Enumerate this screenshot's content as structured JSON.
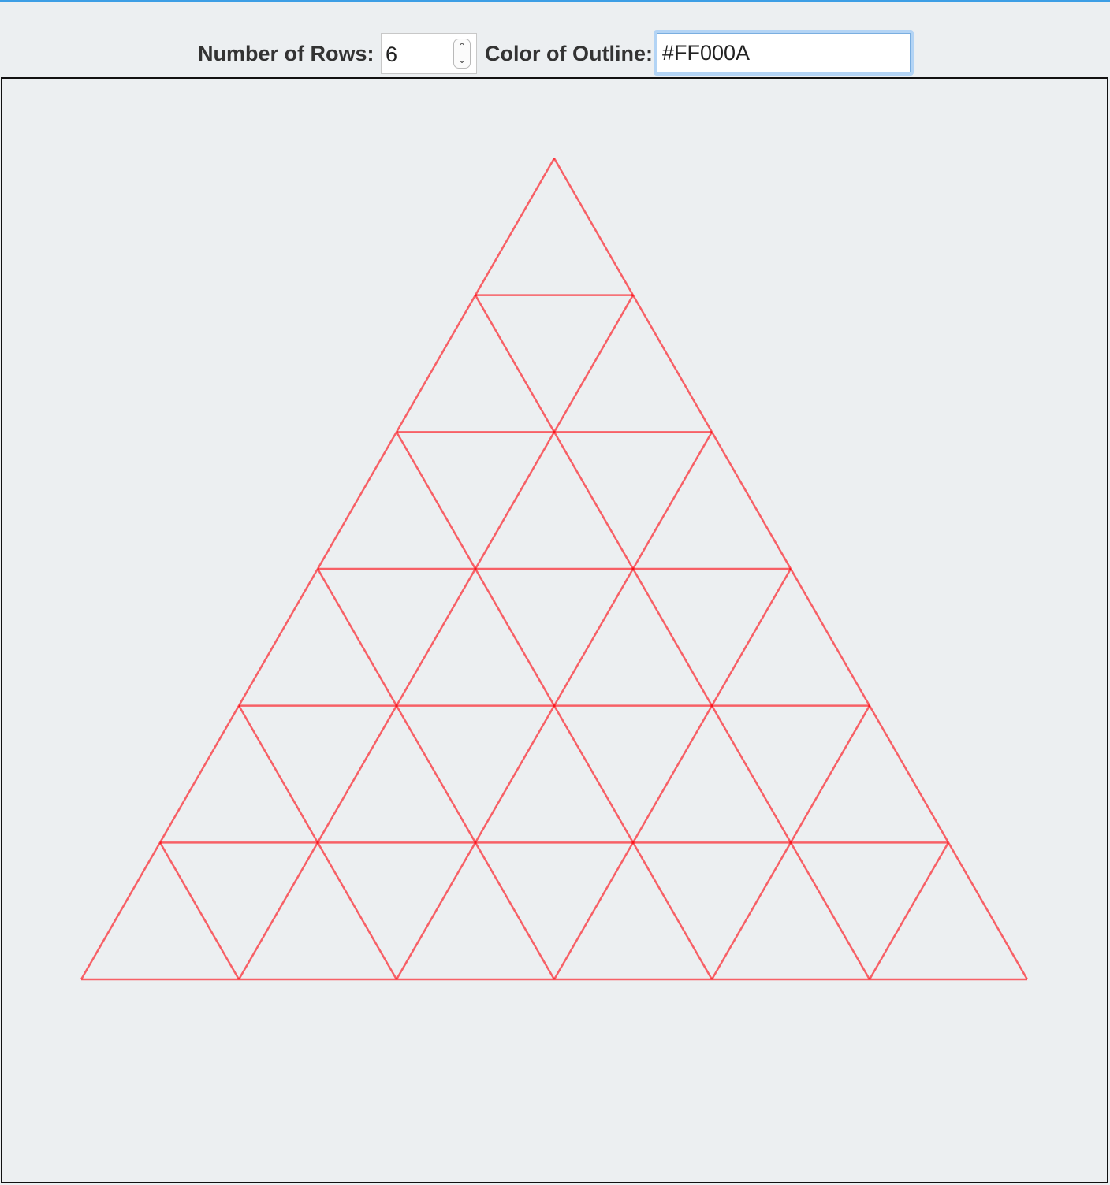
{
  "controls": {
    "rows_label": "Number of Rows:",
    "rows_value": "6",
    "outline_label": "Color of Outline:",
    "outline_value": "#FF000A"
  },
  "drawing": {
    "rows": 6,
    "stroke_color": "#FF000A"
  }
}
